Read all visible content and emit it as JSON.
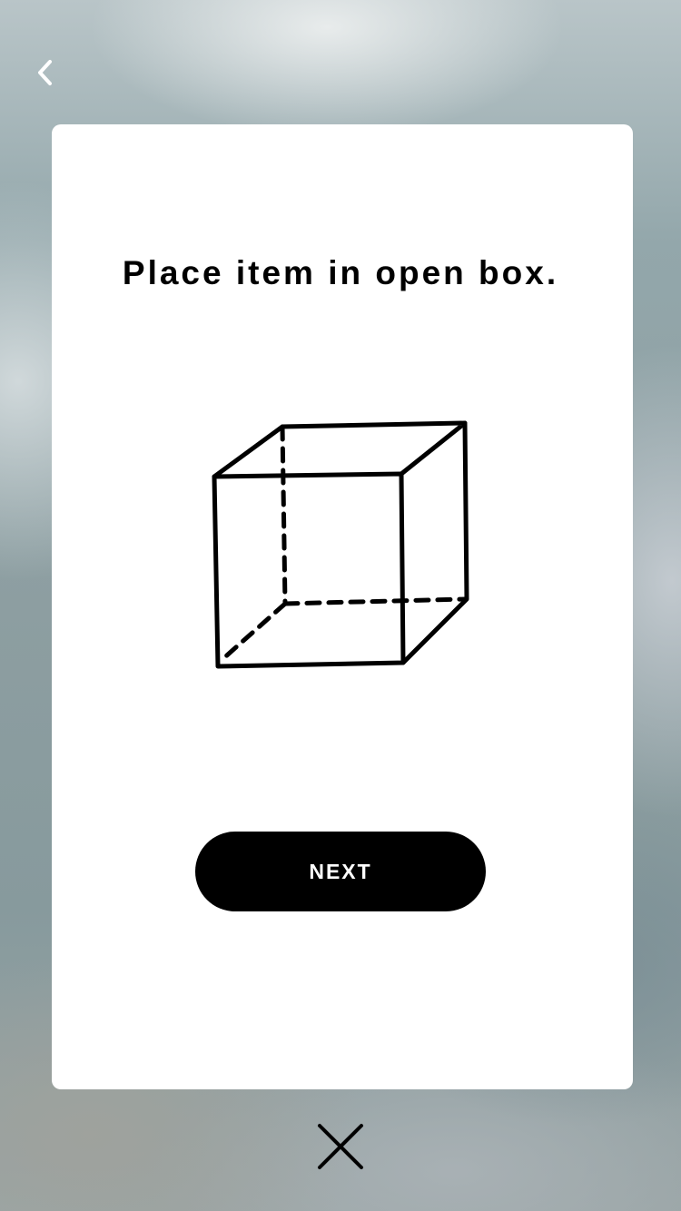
{
  "nav": {
    "back_icon": "chevron-left-icon",
    "close_icon": "close-icon"
  },
  "card": {
    "title": "Place item in open box.",
    "illustration_icon": "open-box-icon",
    "next_label": "NEXT"
  },
  "colors": {
    "card_background": "#ffffff",
    "button_background": "#000000",
    "button_text": "#ffffff",
    "text": "#000000"
  }
}
